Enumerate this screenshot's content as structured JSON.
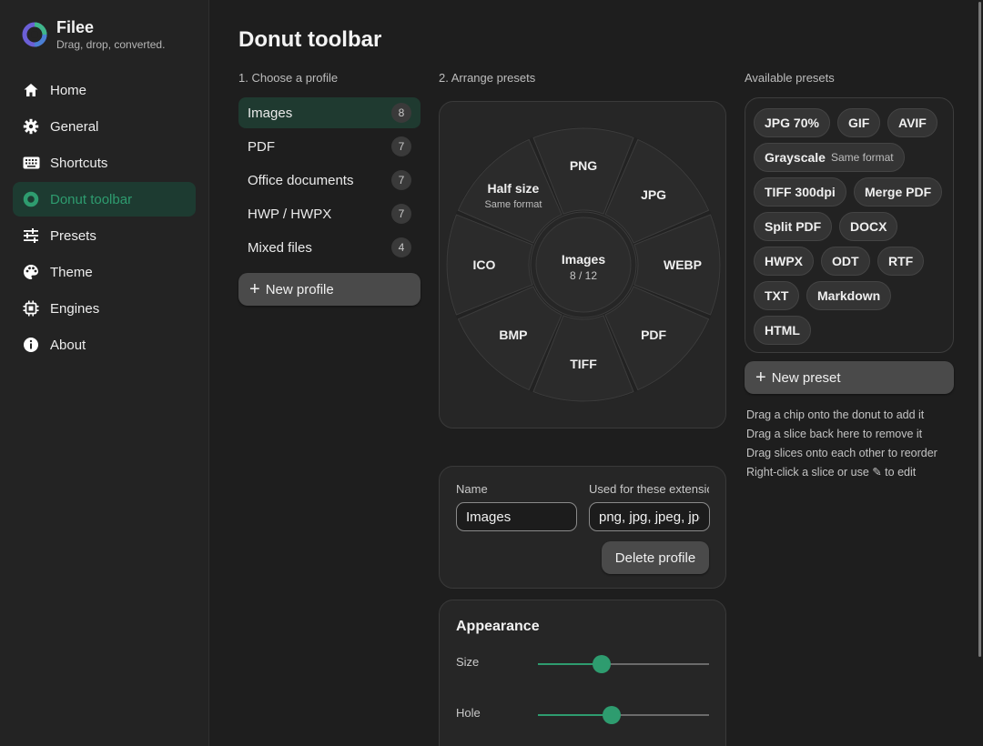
{
  "app": {
    "name": "Filee",
    "tagline": "Drag, drop, converted."
  },
  "nav": [
    {
      "label": "Home",
      "icon": "home-icon",
      "active": false
    },
    {
      "label": "General",
      "icon": "gear-icon",
      "active": false
    },
    {
      "label": "Shortcuts",
      "icon": "keyboard-icon",
      "active": false
    },
    {
      "label": "Donut toolbar",
      "icon": "donut-icon",
      "active": true
    },
    {
      "label": "Presets",
      "icon": "sliders-icon",
      "active": false
    },
    {
      "label": "Theme",
      "icon": "palette-icon",
      "active": false
    },
    {
      "label": "Engines",
      "icon": "chip-icon",
      "active": false
    },
    {
      "label": "About",
      "icon": "info-icon",
      "active": false
    }
  ],
  "page_title": "Donut toolbar",
  "sections": {
    "profiles_label": "1. Choose a profile",
    "arrange_label": "2. Arrange presets",
    "available_label": "Available presets"
  },
  "profiles": [
    {
      "label": "Images",
      "count": "8",
      "active": true
    },
    {
      "label": "PDF",
      "count": "7",
      "active": false
    },
    {
      "label": "Office documents",
      "count": "7",
      "active": false
    },
    {
      "label": "HWP / HWPX",
      "count": "7",
      "active": false
    },
    {
      "label": "Mixed files",
      "count": "4",
      "active": false
    }
  ],
  "new_profile_label": "New profile",
  "donut": {
    "center_title": "Images",
    "center_count": "8 / 12",
    "slices": [
      {
        "label": "PNG",
        "sub": ""
      },
      {
        "label": "JPG",
        "sub": ""
      },
      {
        "label": "WEBP",
        "sub": ""
      },
      {
        "label": "PDF",
        "sub": ""
      },
      {
        "label": "TIFF",
        "sub": ""
      },
      {
        "label": "BMP",
        "sub": ""
      },
      {
        "label": "ICO",
        "sub": ""
      },
      {
        "label": "Half size",
        "sub": "Same format"
      }
    ]
  },
  "presets": [
    {
      "label": "JPG 70%",
      "sub": ""
    },
    {
      "label": "GIF",
      "sub": ""
    },
    {
      "label": "AVIF",
      "sub": ""
    },
    {
      "label": "Grayscale",
      "sub": "Same format"
    },
    {
      "label": "TIFF 300dpi",
      "sub": ""
    },
    {
      "label": "Merge PDF",
      "sub": ""
    },
    {
      "label": "Split PDF",
      "sub": ""
    },
    {
      "label": "DOCX",
      "sub": ""
    },
    {
      "label": "HWPX",
      "sub": ""
    },
    {
      "label": "ODT",
      "sub": ""
    },
    {
      "label": "RTF",
      "sub": ""
    },
    {
      "label": "TXT",
      "sub": ""
    },
    {
      "label": "Markdown",
      "sub": ""
    },
    {
      "label": "HTML",
      "sub": ""
    }
  ],
  "new_preset_label": "New preset",
  "hints": [
    "Drag a chip onto the donut to add it",
    "Drag a slice back here to remove it",
    "Drag slices onto each other to reorder",
    "Right-click a slice or use ✎ to edit"
  ],
  "profile_form": {
    "name_label": "Name",
    "name_value": "Images",
    "ext_label": "Used for these extensions",
    "ext_value": "png, jpg, jpeg, jpeg, webp",
    "delete_label": "Delete profile"
  },
  "appearance": {
    "title": "Appearance",
    "size_label": "Size",
    "size_value": 0.37,
    "hole_label": "Hole",
    "hole_value": 0.43
  },
  "colors": {
    "accent": "#2e9c6f",
    "active_bg": "#1d3b31"
  }
}
